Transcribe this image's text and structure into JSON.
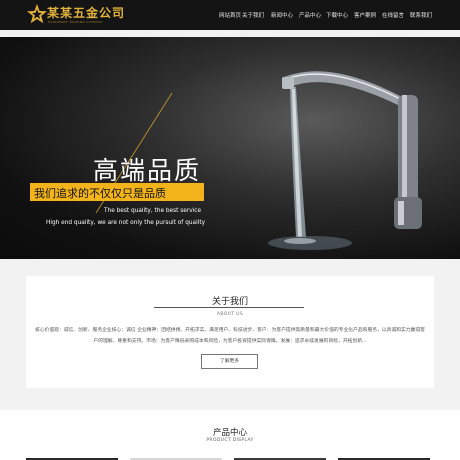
{
  "header": {
    "logo_title": "某某五金公司",
    "logo_subtitle": "HARDWARE TRADING COMPANY",
    "nav": [
      "网站首页",
      "关于我们",
      "新闻中心",
      "产品中心",
      "下载中心",
      "客户案例",
      "在线留言",
      "联系我们"
    ]
  },
  "banner": {
    "headline": "高端品质",
    "tagline": "我们追求的不仅仅只是品质",
    "english_line1": "The best quality, the best service",
    "english_line2": "High end quality, we are not only the pursuit of quality",
    "slides_total": 2,
    "active_slide": 1
  },
  "about": {
    "title": "关于我们",
    "subtitle": "ABOUT US",
    "text": "核心价值观：诚信、创新、服务企业核心：诚信 企业精神：团结拼搏、开拓求实、满足用户、科技进步、客户：为客户提供高质量和最大价值的专业化产品和服务，以真诚和实力赢得客户的理解、尊重和支持。市场：为客户降低采购成本和风险，为客户投资提供实际保障。发展：追求永续发展的目标，开拓创新...",
    "more_label": "了解更多"
  },
  "products": {
    "title": "产品中心",
    "subtitle": "PRODUCT DISPLAY"
  },
  "colors": {
    "header_bg": "#141414",
    "brand_gold": "#e3b23c",
    "tag_yellow": "#f3b31b",
    "page_bg": "#f2f2f2"
  }
}
